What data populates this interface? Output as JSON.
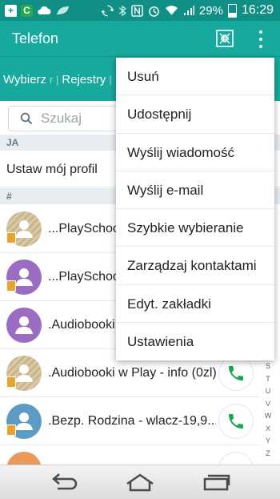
{
  "status_bar": {
    "battery": "29%",
    "time": "16:29",
    "icons": [
      "add-icon",
      "app-badge-icon",
      "cloud-icon",
      "leaf-icon",
      "sync-icon",
      "bluetooth-icon",
      "nfc-icon",
      "alarm-icon",
      "wifi-icon",
      "signal-icon",
      "battery-icon"
    ]
  },
  "app_bar": {
    "title": "Telefon",
    "icons": [
      "compress-icon",
      "more-vert-icon"
    ]
  },
  "tabs": [
    "Wybierz",
    "Rejestry"
  ],
  "search": {
    "placeholder": "Szukaj"
  },
  "sections": {
    "me": "JA",
    "hash": "#"
  },
  "profile": {
    "label": "Ustaw mój profil"
  },
  "contacts": [
    {
      "name": "...PlaySchool",
      "avatar": "tan"
    },
    {
      "name": "...PlaySchool",
      "avatar": "purple"
    },
    {
      "name": ".Audiobooki",
      "avatar": "purple"
    },
    {
      "name": ".Audiobooki w Play - info (0zl)",
      "avatar": "tan"
    },
    {
      "name": ".Bezp. Rodzina  - wlacz-19,9...",
      "avatar": "blue"
    },
    {
      "name": "",
      "avatar": "orange"
    }
  ],
  "alphabet": [
    "S",
    "T",
    "U",
    "V",
    "W",
    "X",
    "Y",
    "Z"
  ],
  "menu": {
    "items": [
      "Usuń",
      "Udostępnij",
      "Wyślij wiadomość",
      "Wyślij e-mail",
      "Szybkie wybieranie",
      "Zarządzaj kontaktami",
      "Edyt. zakładki",
      "Ustawienia"
    ]
  },
  "nav": {
    "icons": [
      "back-icon",
      "home-icon",
      "recents-icon"
    ]
  },
  "colors": {
    "status_bar": "#0f8f86",
    "app_bar": "#17a99d",
    "call_green": "#1aa64b"
  }
}
